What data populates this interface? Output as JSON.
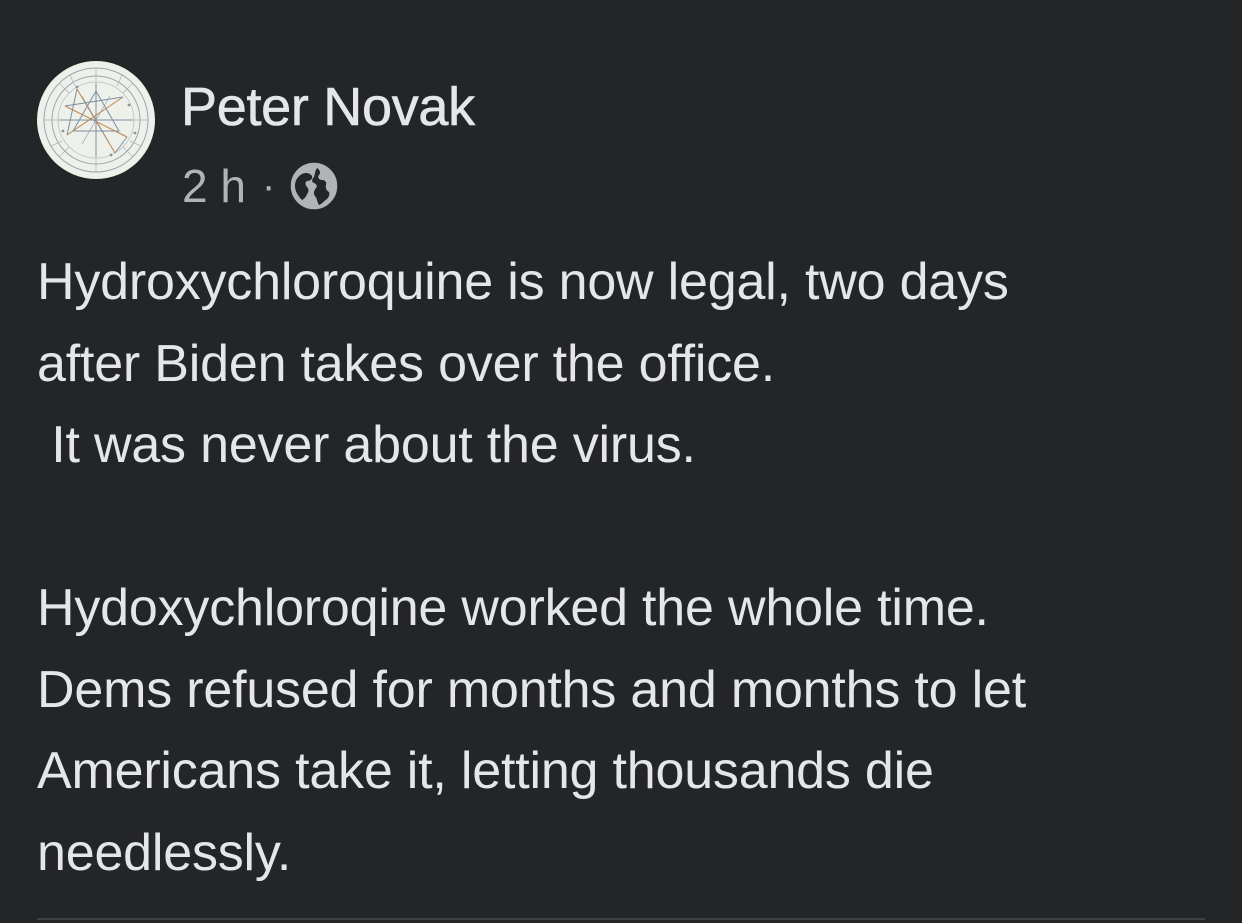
{
  "author": {
    "name": "Peter Novak",
    "avatar_icon": "astrology-chart-avatar"
  },
  "meta": {
    "time": "2 h",
    "separator": "·",
    "audience_icon": "globe-icon"
  },
  "post": {
    "lines": [
      "Hydroxychloroquine is now legal, two days",
      "after Biden takes over the office.",
      " It was never about the virus.",
      "",
      "Hydoxychloroqine worked the whole time.",
      "Dems refused for months and months to let",
      "Americans take it, letting thousands die",
      "needlessly."
    ]
  },
  "colors": {
    "background": "#242526",
    "primary_text": "#e4e6eb",
    "secondary_text": "#b0b3b8",
    "divider": "#3e4042"
  }
}
